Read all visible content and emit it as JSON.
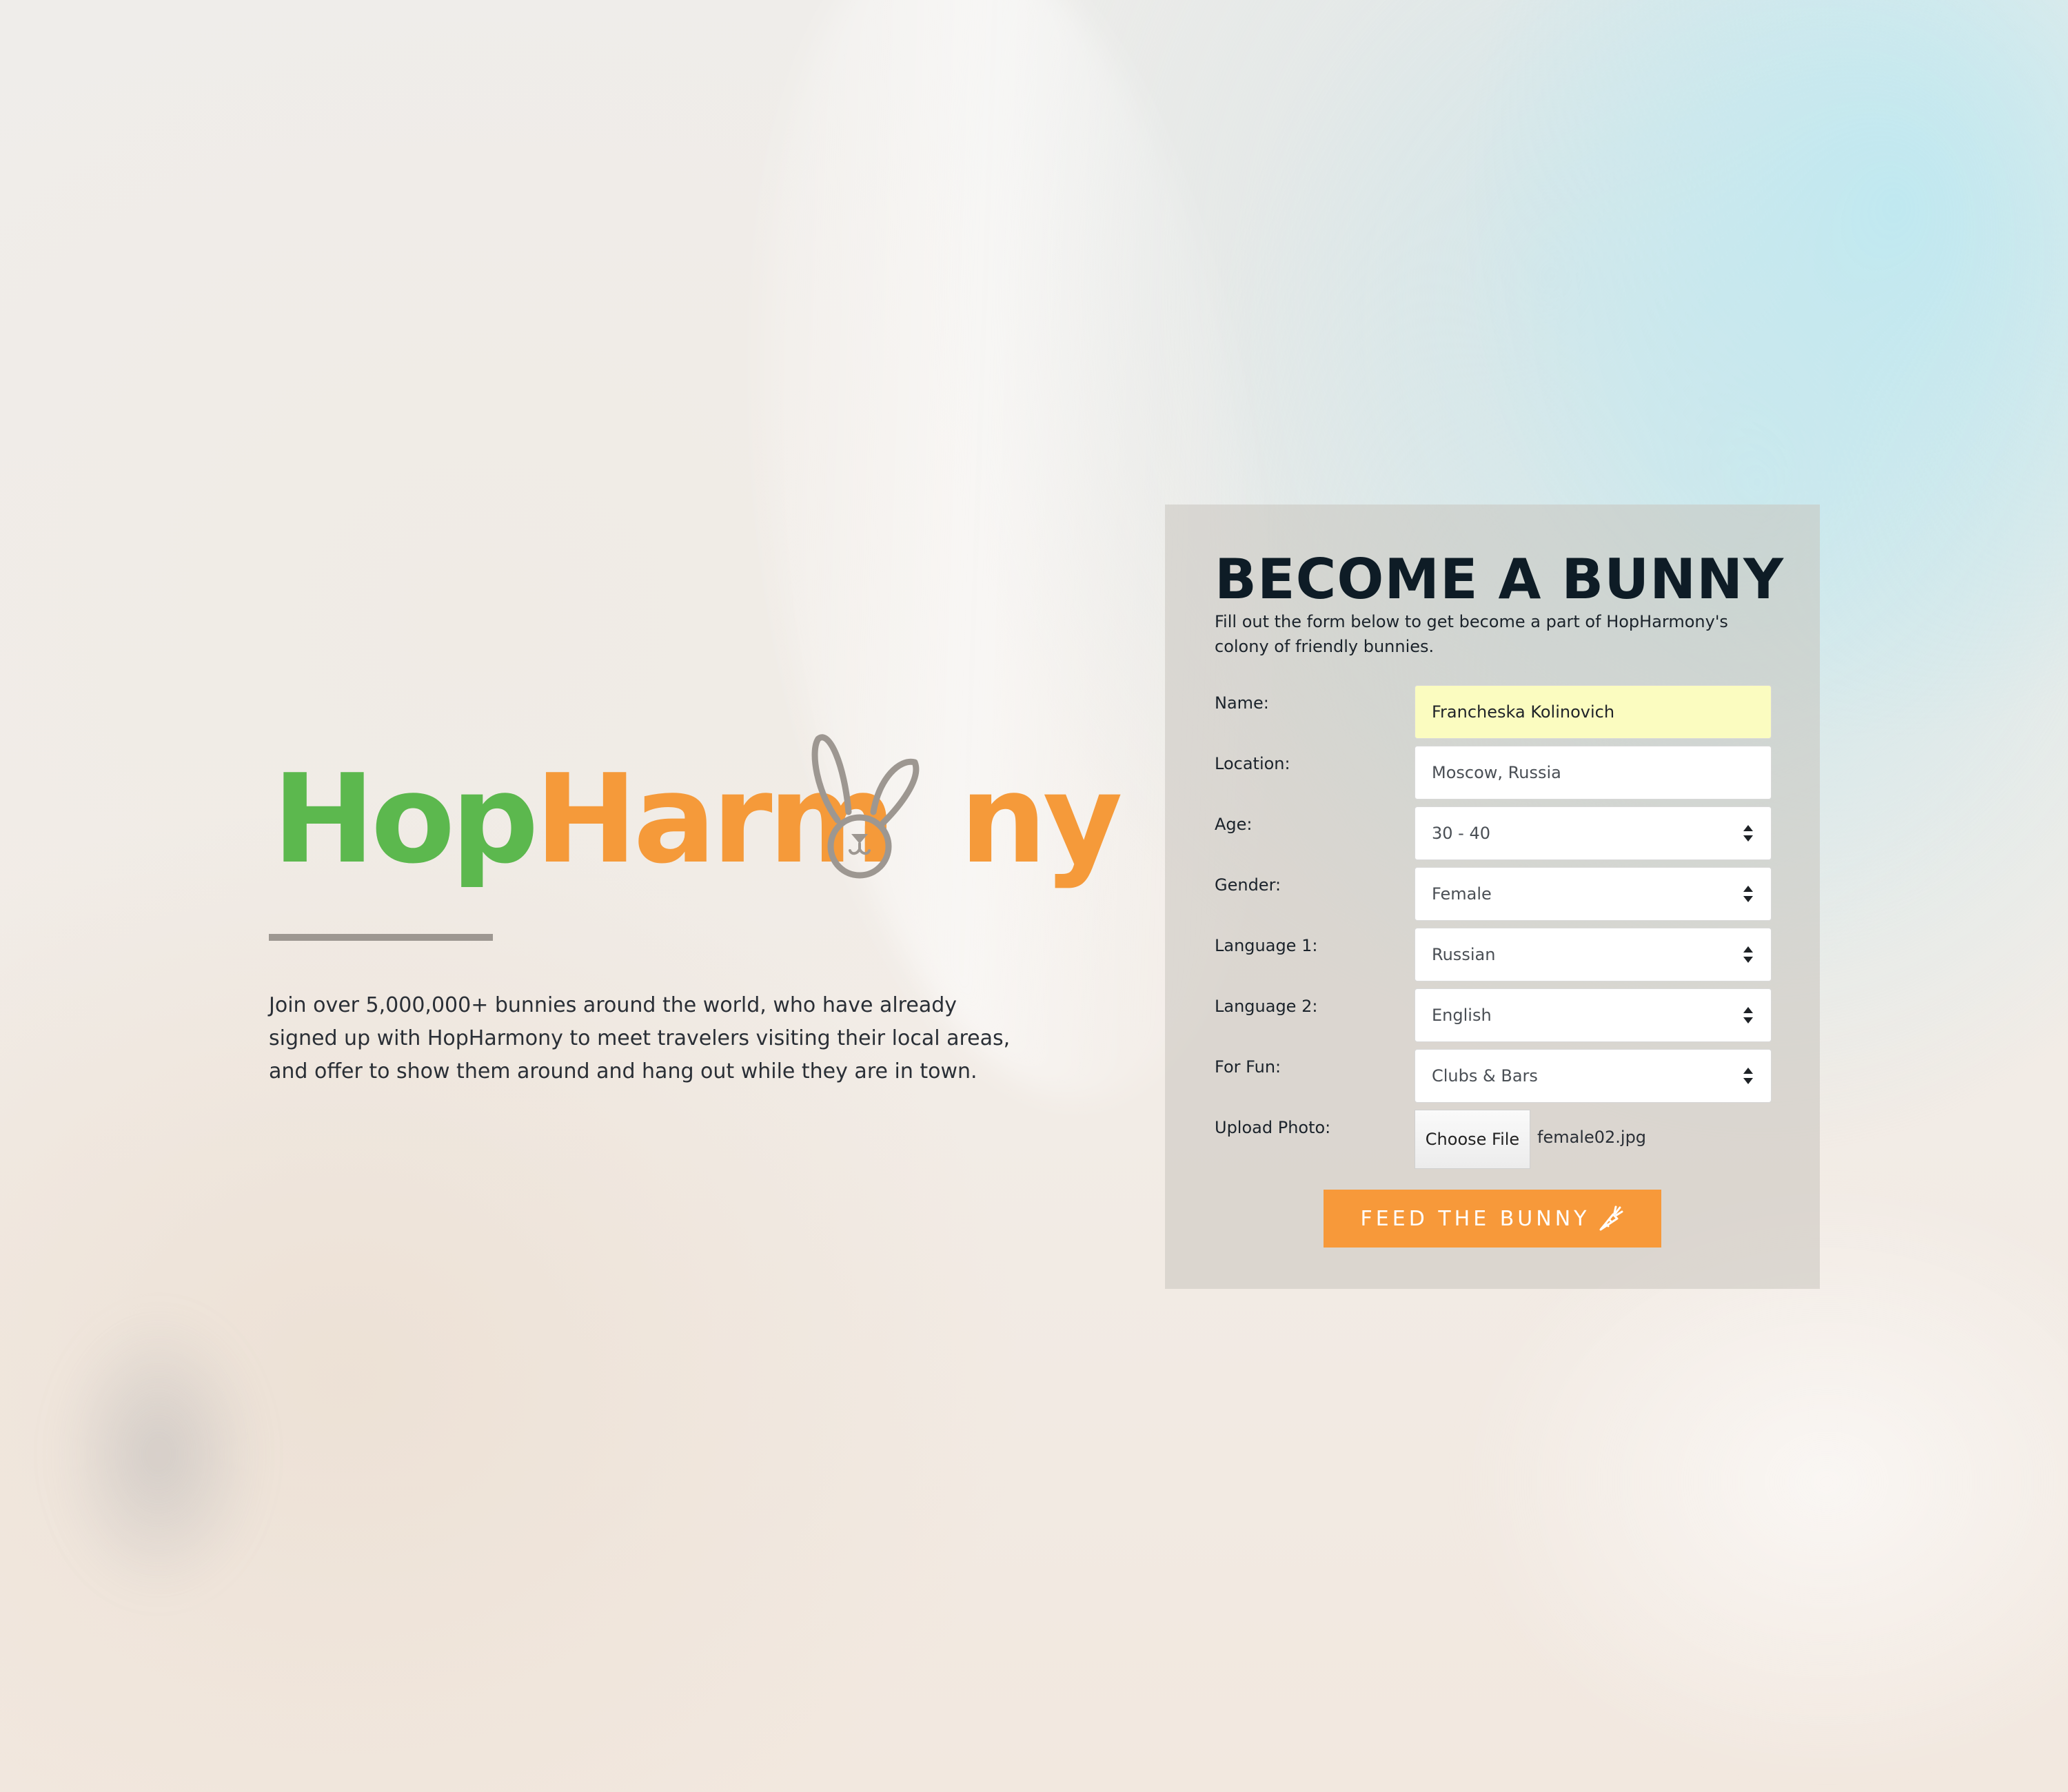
{
  "brand": {
    "part1": "Hop",
    "part2": "Harm",
    "part3": "ny",
    "colors": {
      "green": "#5cb84e",
      "orange": "#f59a3a",
      "gray": "#9d9791"
    }
  },
  "intro": {
    "text": "Join over 5,000,000+ bunnies around the world, who have already signed up with HopHarmony to meet travelers visiting their local areas, and offer to show them around and hang out while they are in town."
  },
  "form": {
    "title": "BECOME A BUNNY",
    "subtitle": "Fill out the form below to get become a part of HopHarmony's colony of friendly bunnies.",
    "name": {
      "label": "Name:",
      "value": "Francheska Kolinovich"
    },
    "location": {
      "label": "Location:",
      "value": "Moscow, Russia"
    },
    "age": {
      "label": "Age:",
      "value": "30 - 40"
    },
    "gender": {
      "label": "Gender:",
      "value": "Female"
    },
    "language1": {
      "label": "Language 1:",
      "value": "Russian"
    },
    "language2": {
      "label": "Language 2:",
      "value": "English"
    },
    "for_fun": {
      "label": "For Fun:",
      "value": "Clubs & Bars"
    },
    "upload": {
      "label": "Upload Photo:",
      "button": "Choose File",
      "filename": "female02.jpg"
    },
    "submit": {
      "label": "FEED THE BUNNY",
      "icon": "carrot-icon",
      "color": "#f7993a"
    }
  }
}
